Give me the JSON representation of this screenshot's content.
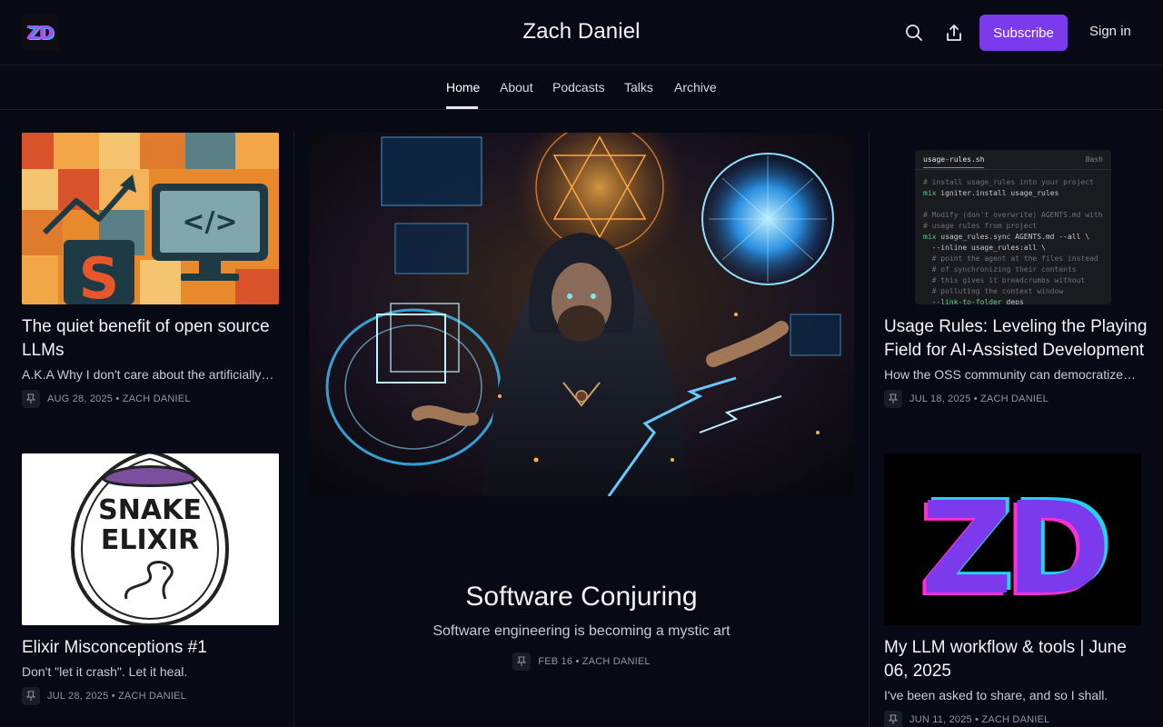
{
  "header": {
    "logo_text": "ZD",
    "site_title": "Zach Daniel",
    "subscribe_label": "Subscribe",
    "signin_label": "Sign in"
  },
  "nav": {
    "items": [
      {
        "label": "Home",
        "active": true
      },
      {
        "label": "About"
      },
      {
        "label": "Podcasts"
      },
      {
        "label": "Talks"
      },
      {
        "label": "Archive"
      }
    ]
  },
  "posts": {
    "left_top": {
      "title": "The quiet benefit of open source LLMs",
      "excerpt": "A.K.A Why I don't care about the artificially…",
      "date": "AUG 28, 2025",
      "author": "• ZACH DANIEL",
      "image_text": "</>"
    },
    "left_bottom": {
      "title": "Elixir Misconceptions #1",
      "excerpt": "Don't \"let it crash\". Let it heal.",
      "date": "JUL 28, 2025",
      "author": "• ZACH DANIEL",
      "image_line1": "SNAKE",
      "image_line2": "ELIXIR"
    },
    "feature": {
      "title": "Software Conjuring",
      "subtitle": "Software engineering is becoming a mystic art",
      "date": "FEB 16",
      "author": "• ZACH DANIEL"
    },
    "right_top": {
      "title": "Usage Rules: Leveling the Playing Field for AI-Assisted Development",
      "excerpt": "How the OSS community can democratize…",
      "date": "JUL 18, 2025",
      "author": "• ZACH DANIEL",
      "code_tab": "usage-rules.sh",
      "code_lang": "Bash"
    },
    "right_bottom": {
      "title": "My LLM workflow & tools | June 06, 2025",
      "excerpt": "I've been asked to share, and so I shall.",
      "date": "JUN 11, 2025",
      "author": "• ZACH DANIEL",
      "image_text": "ZD"
    }
  },
  "colors": {
    "background": "#070914",
    "accent": "#7c3aed",
    "border": "#1c1f2b"
  }
}
